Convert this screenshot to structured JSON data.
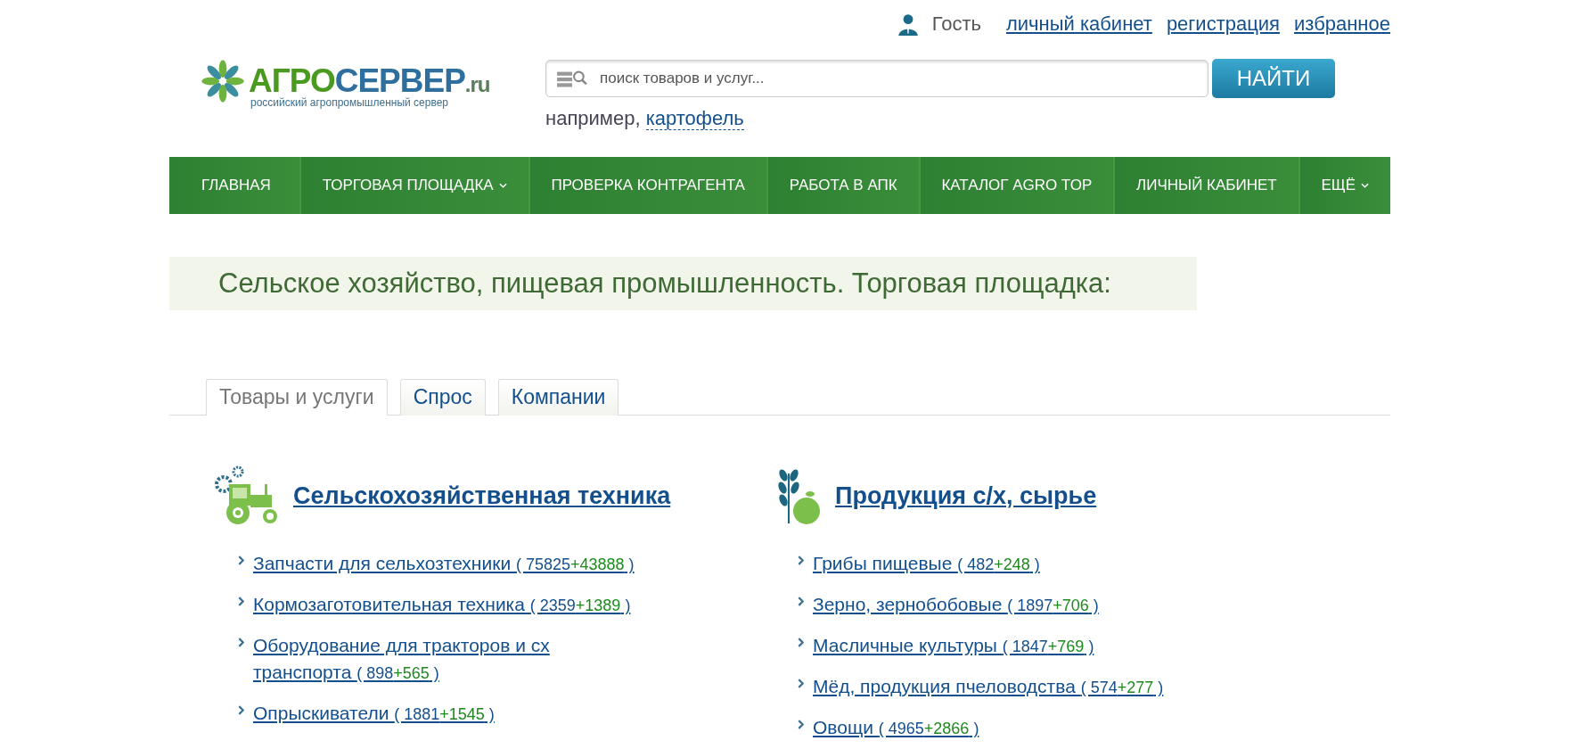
{
  "top_links": {
    "user": "Гость",
    "links": [
      "личный кабинет",
      "регистрация",
      "избранное"
    ]
  },
  "logo": {
    "part_1": "АГРО",
    "part_2": "СЕРВЕР",
    "part_3": ".ru",
    "tagline": "российский агропромышленный сервер"
  },
  "search": {
    "placeholder": "поиск товаров и услуг...",
    "button": "НАЙТИ",
    "example_label": "например,",
    "example_link": "картофель"
  },
  "nav": [
    {
      "label": "ГЛАВНАЯ",
      "dropdown": false
    },
    {
      "label": "ТОРГОВАЯ ПЛОЩАДКА",
      "dropdown": true
    },
    {
      "label": "ПРОВЕРКА КОНТРАГЕНТА",
      "dropdown": false
    },
    {
      "label": "РАБОТА В АПК",
      "dropdown": false
    },
    {
      "label": "КАТАЛОГ AGRO TOP",
      "dropdown": false
    },
    {
      "label": "ЛИЧНЫЙ КАБИНЕТ",
      "dropdown": false
    },
    {
      "label": "ЕЩЁ",
      "dropdown": true
    }
  ],
  "page_heading": "Сельское хозяйство, пищевая промышленность. Торговая площадка:",
  "tabs": [
    {
      "label": "Товары и услуги",
      "selected": true
    },
    {
      "label": "Спрос",
      "selected": false
    },
    {
      "label": "Компании",
      "selected": false
    }
  ],
  "categories": [
    {
      "kind": "machinery",
      "title": "Сельскохозяйственная техника",
      "items": [
        {
          "label": "Запчасти для сельхозтехники",
          "total": "( 75825",
          "added": "+43888",
          "tail": ")"
        },
        {
          "label": "Кормозаготовительная техника",
          "total": "( 2359",
          "added": "+1389",
          "tail": ")"
        },
        {
          "label": "Оборудование для тракторов и сх транспорта",
          "total": "( 898",
          "added": "+565",
          "tail": ")"
        },
        {
          "label": "Опрыскиватели",
          "total": "( 1881",
          "added": "+1545",
          "tail": ")"
        }
      ]
    },
    {
      "kind": "produce",
      "title": "Продукция с/х, сырье",
      "items": [
        {
          "label": "Грибы пищевые",
          "total": "( 482",
          "added": "+248",
          "tail": ")"
        },
        {
          "label": "Зерно, зернобобовые",
          "total": "( 1897",
          "added": "+706",
          "tail": ")"
        },
        {
          "label": "Масличные культуры",
          "total": "( 1847",
          "added": "+769",
          "tail": ")"
        },
        {
          "label": "Мёд, продукция пчеловодства",
          "total": "( 574",
          "added": "+277",
          "tail": ")"
        },
        {
          "label": "Овощи",
          "total": "( 4965",
          "added": "+2866",
          "tail": ")"
        }
      ]
    }
  ]
}
